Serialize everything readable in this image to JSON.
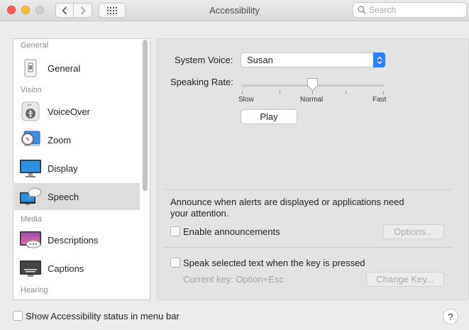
{
  "window": {
    "title": "Accessibility",
    "search_placeholder": "Search"
  },
  "sidebar": {
    "headers": [
      "General",
      "Vision",
      "Media",
      "Hearing"
    ],
    "items": [
      {
        "label": "General",
        "icon": "switch-icon"
      },
      {
        "label": "VoiceOver",
        "icon": "voiceover-icon"
      },
      {
        "label": "Zoom",
        "icon": "magnifier-icon"
      },
      {
        "label": "Display",
        "icon": "monitor-icon"
      },
      {
        "label": "Speech",
        "icon": "speech-bubble-icon",
        "selected": true
      },
      {
        "label": "Descriptions",
        "icon": "descriptions-icon"
      },
      {
        "label": "Captions",
        "icon": "captions-icon"
      }
    ]
  },
  "speech": {
    "system_voice_label": "System Voice:",
    "system_voice_value": "Susan",
    "speaking_rate_label": "Speaking Rate:",
    "rate_ticks": {
      "slow": "Slow",
      "normal": "Normal",
      "fast": "Fast"
    },
    "rate_value": 0.5,
    "play_label": "Play",
    "announce_text_line1": "Announce when alerts are displayed or applications need",
    "announce_text_line2": "your attention.",
    "enable_announcements_label": "Enable announcements",
    "options_label": "Options...",
    "speak_selected_label": "Speak selected text when the key is pressed",
    "current_key_label": "Current key: Option+Esc",
    "change_key_label": "Change Key..."
  },
  "footer": {
    "show_status_label": "Show Accessibility status in menu bar",
    "help_label": "?"
  },
  "colors": {
    "accent": "#2d7ff9",
    "close": "#fe5f57",
    "minimize": "#febc2e",
    "selected_row": "#dcdcdc"
  }
}
